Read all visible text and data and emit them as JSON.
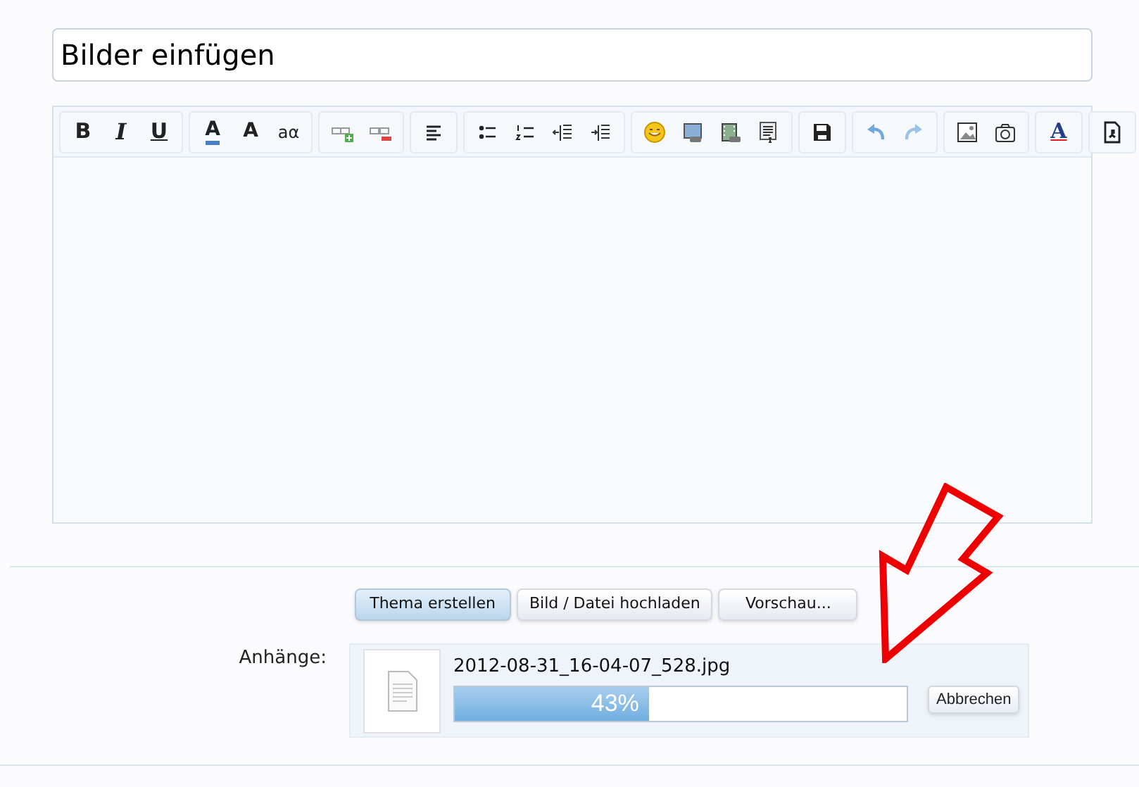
{
  "title_field": {
    "value": "Bilder einfügen"
  },
  "toolbar": [
    {
      "buttons": [
        {
          "kind": "text",
          "label": "B"
        },
        {
          "kind": "text",
          "label": "I"
        },
        {
          "kind": "text",
          "label": "U"
        }
      ]
    },
    {
      "buttons": [
        {
          "kind": "text",
          "label": "A"
        },
        {
          "kind": "text",
          "label": "A"
        },
        {
          "kind": "text",
          "label": "aα"
        }
      ]
    },
    {
      "buttons": [
        {
          "kind": "icon"
        },
        {
          "kind": "icon"
        }
      ]
    },
    {
      "buttons": [
        {
          "kind": "icon"
        }
      ]
    },
    {
      "buttons": [
        {
          "kind": "icon"
        },
        {
          "kind": "icon"
        },
        {
          "kind": "icon"
        },
        {
          "kind": "icon"
        }
      ]
    },
    {
      "buttons": [
        {
          "kind": "icon"
        },
        {
          "kind": "icon"
        },
        {
          "kind": "icon"
        },
        {
          "kind": "icon"
        }
      ]
    },
    {
      "buttons": [
        {
          "kind": "icon"
        }
      ]
    },
    {
      "buttons": [
        {
          "kind": "icon"
        },
        {
          "kind": "icon"
        }
      ]
    },
    {
      "buttons": [
        {
          "kind": "icon"
        },
        {
          "kind": "icon"
        }
      ]
    },
    {
      "buttons": [
        {
          "kind": "text",
          "label": "A"
        }
      ]
    },
    {
      "buttons": [
        {
          "kind": "icon"
        }
      ]
    }
  ],
  "actions": [
    {
      "label": "Thema erstellen",
      "primary": true
    },
    {
      "label": "Bild / Datei hochladen",
      "primary": false
    },
    {
      "label": "Vorschau...",
      "primary": false
    }
  ],
  "attachments": {
    "label": "Anhänge:",
    "file": {
      "name": "2012-08-31_16-04-07_528.jpg",
      "level": 0.43,
      "reading": "43%",
      "cancel": "Abbrechen"
    }
  }
}
